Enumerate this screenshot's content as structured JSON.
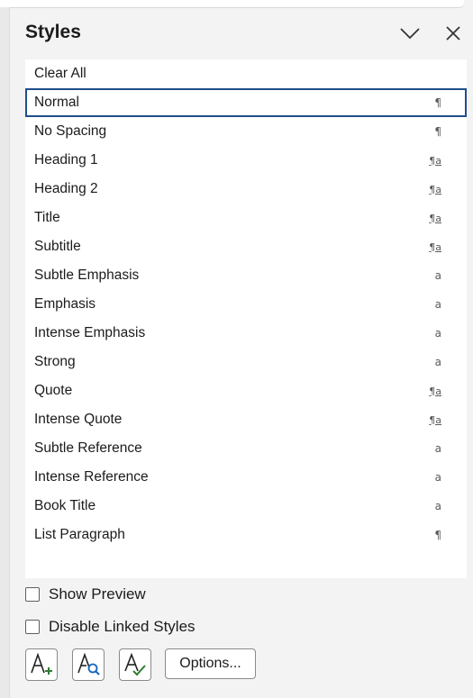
{
  "pane": {
    "title": "Styles"
  },
  "styles": [
    {
      "name": "Clear All",
      "type_glyph": "",
      "kind": "none"
    },
    {
      "name": "Normal",
      "type_glyph": "¶",
      "kind": "paragraph",
      "selected": true
    },
    {
      "name": "No Spacing",
      "type_glyph": "¶",
      "kind": "paragraph"
    },
    {
      "name": "Heading 1",
      "type_glyph": "¶a",
      "kind": "linked"
    },
    {
      "name": "Heading 2",
      "type_glyph": "¶a",
      "kind": "linked"
    },
    {
      "name": "Title",
      "type_glyph": "¶a",
      "kind": "linked"
    },
    {
      "name": "Subtitle",
      "type_glyph": "¶a",
      "kind": "linked"
    },
    {
      "name": "Subtle Emphasis",
      "type_glyph": "a",
      "kind": "character"
    },
    {
      "name": "Emphasis",
      "type_glyph": "a",
      "kind": "character"
    },
    {
      "name": "Intense Emphasis",
      "type_glyph": "a",
      "kind": "character"
    },
    {
      "name": "Strong",
      "type_glyph": "a",
      "kind": "character"
    },
    {
      "name": "Quote",
      "type_glyph": "¶a",
      "kind": "linked"
    },
    {
      "name": "Intense Quote",
      "type_glyph": "¶a",
      "kind": "linked"
    },
    {
      "name": "Subtle Reference",
      "type_glyph": "a",
      "kind": "character"
    },
    {
      "name": "Intense Reference",
      "type_glyph": "a",
      "kind": "character"
    },
    {
      "name": "Book Title",
      "type_glyph": "a",
      "kind": "character"
    },
    {
      "name": "List Paragraph",
      "type_glyph": "¶",
      "kind": "paragraph"
    }
  ],
  "options": {
    "show_preview": {
      "label": "Show Preview",
      "checked": false
    },
    "disable_linked_styles": {
      "label": "Disable Linked Styles",
      "checked": false
    }
  },
  "toolbar": {
    "new_style_icon": "new-style-icon",
    "style_inspector_icon": "style-inspector-icon",
    "manage_styles_icon": "manage-styles-icon",
    "options_label": "Options..."
  },
  "colors": {
    "selection_border": "#1f4e8c",
    "accent_plus": "#2e7d32",
    "accent_magnifier": "#1565c0"
  }
}
